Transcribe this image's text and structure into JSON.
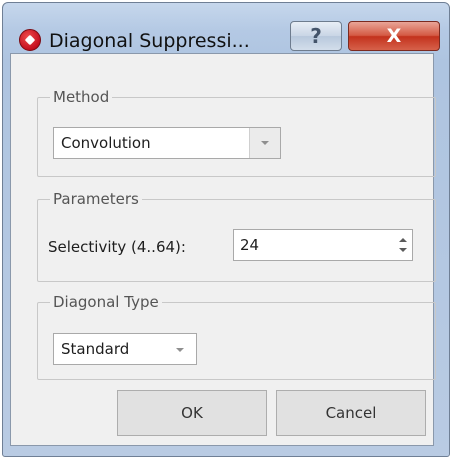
{
  "window": {
    "title": "Diagonal Suppressi...",
    "help_label": "?",
    "close_label": "X"
  },
  "method": {
    "label": "Method",
    "selected": "Convolution"
  },
  "parameters": {
    "label": "Parameters",
    "selectivity_label": "Selectivity (4..64):",
    "selectivity_value": "24"
  },
  "diagonal_type": {
    "label": "Diagonal Type",
    "selected": "Standard"
  },
  "buttons": {
    "ok": "OK",
    "cancel": "Cancel"
  },
  "icons": [
    "app-logo-icon",
    "help-icon",
    "close-icon",
    "chevron-down-icon",
    "spin-up-icon",
    "spin-down-icon"
  ],
  "colors": {
    "close_button": "#c3321d",
    "frame": "#b4c9e4",
    "client_bg": "#f0f0f0"
  }
}
